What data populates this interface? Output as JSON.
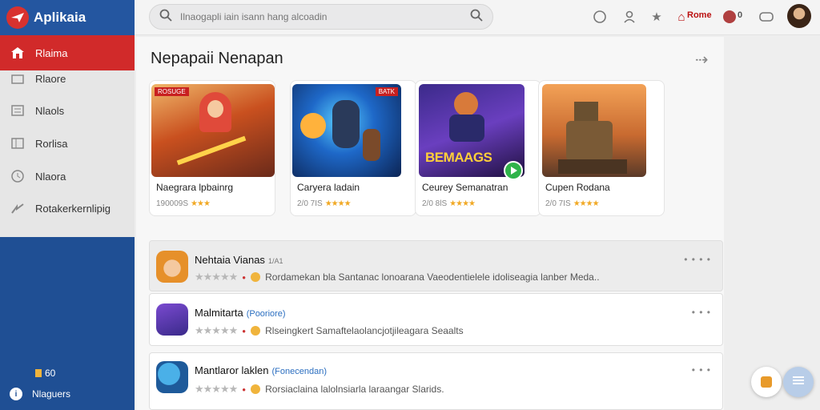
{
  "brand": {
    "name": "Aplikaia"
  },
  "nav": {
    "items": [
      {
        "label": "Rlaima",
        "icon": "home-icon"
      },
      {
        "label": "Rlaore",
        "icon": "store-icon"
      },
      {
        "label": "Nlaols",
        "icon": "list-icon"
      },
      {
        "label": "Rorlisa",
        "icon": "library-icon"
      },
      {
        "label": "Nlaora",
        "icon": "clock-icon"
      },
      {
        "label": "Rotakerkernlipig",
        "icon": "share-icon"
      }
    ],
    "bottom": [
      {
        "label": "60",
        "icon": "badge-icon"
      },
      {
        "label": "Nlaguers",
        "icon": "info-icon"
      }
    ]
  },
  "topbar": {
    "search_placeholder": "Ilnaogapli iain isann hang alcoadin",
    "home_label": "Rome",
    "badge_count": "0"
  },
  "section": {
    "title": "Nepapaii Nenapan"
  },
  "cards": [
    {
      "title": "Naegrara lpbainrg",
      "size": "190009S",
      "rating": "★★★",
      "banner": "ROSUGE"
    },
    {
      "title": "Caryera ladain",
      "size": "2/0 7IS",
      "rating": "★★★★",
      "banner": "BATK"
    },
    {
      "title": "Ceurey Semanatran",
      "size": "2/0 8lS",
      "rating": "★★★★",
      "banner": "BEMAAGS"
    },
    {
      "title": "Cupen Rodana",
      "size": "2/0 7IS",
      "rating": "★★★★",
      "banner": ""
    }
  ],
  "list": [
    {
      "title": "Nehtaia Vianas",
      "tag": "",
      "sub": "1/A1",
      "stars": "★★★★★",
      "desc": "Rordamekan bla Santanac lonoarana Vaeodentielele idoliseagia lanber Meda.."
    },
    {
      "title": "Malmitarta",
      "tag": "(Pooriore)",
      "sub": "",
      "stars": "★★★★★",
      "desc": "Rlseingkert Samaftelaolancjotjileagara Seaalts"
    },
    {
      "title": "Mantlaror laklen",
      "tag": "(Fonecendan)",
      "sub": "",
      "stars": "★★★★★",
      "desc": "Rorsiaclaina lalolnsiarla laraangar Slarids."
    }
  ],
  "colors": {
    "sidebar": "#1f4f94",
    "active": "#d12a2a",
    "star": "#f1a925"
  }
}
